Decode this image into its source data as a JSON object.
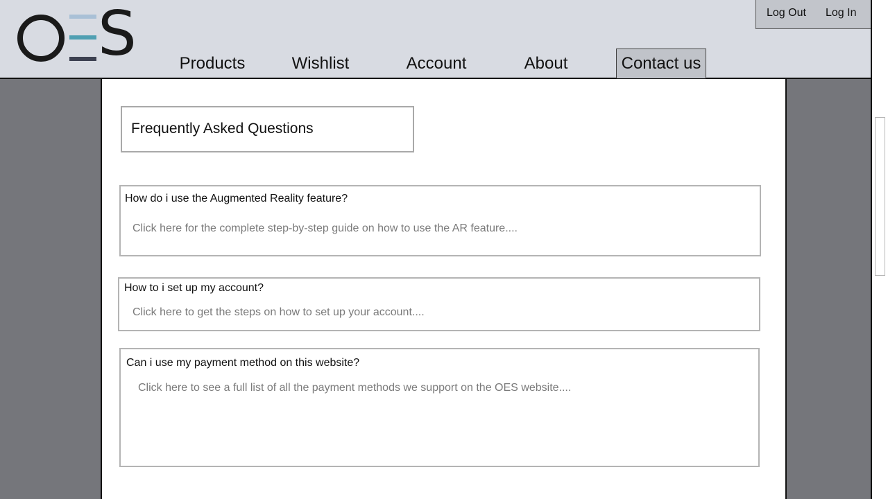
{
  "brand": {
    "logo_text": "OES"
  },
  "auth": {
    "logout_label": "Log Out",
    "login_label": "Log In"
  },
  "nav": {
    "items": [
      {
        "label": "Products"
      },
      {
        "label": "Wishlist"
      },
      {
        "label": "Account"
      },
      {
        "label": "About"
      },
      {
        "label": "Contact us",
        "active": true
      }
    ]
  },
  "faq": {
    "title": "Frequently Asked Questions",
    "items": [
      {
        "question": "How do i use the Augmented Reality feature?",
        "answer": "Click here for the complete step-by-step guide on how to use the AR feature...."
      },
      {
        "question": "How to i set up my account?",
        "answer": "Click here to get the steps on how to set up your account...."
      },
      {
        "question": "Can i use my payment method on this website?",
        "answer": "Click here to see a full list of all the payment methods we support on the OES website...."
      }
    ]
  },
  "colors": {
    "header_bg": "#d8dbe2",
    "side_bg": "#75767b",
    "content_bg": "#ffffff",
    "logo_bar_top": "#a9c0d6",
    "logo_bar_mid": "#4f9fb2",
    "logo_bar_bottom": "#3d4151"
  }
}
